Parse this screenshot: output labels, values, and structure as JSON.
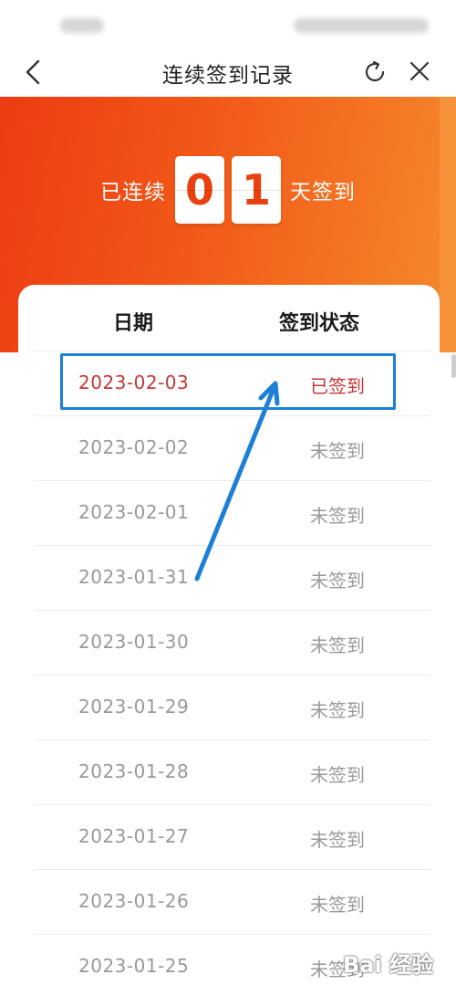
{
  "nav": {
    "title": "连续签到记录",
    "back_icon": "chevron-left-icon",
    "refresh_icon": "refresh-icon",
    "close_icon": "close-icon"
  },
  "banner": {
    "prefix": "已连续",
    "digits": [
      "0",
      "1"
    ],
    "suffix": "天签到"
  },
  "table": {
    "headers": {
      "date": "日期",
      "status": "签到状态"
    },
    "rows": [
      {
        "date": "2023-02-03",
        "status": "已签到",
        "signed": true
      },
      {
        "date": "2023-02-02",
        "status": "未签到",
        "signed": false
      },
      {
        "date": "2023-02-01",
        "status": "未签到",
        "signed": false
      },
      {
        "date": "2023-01-31",
        "status": "未签到",
        "signed": false
      },
      {
        "date": "2023-01-30",
        "status": "未签到",
        "signed": false
      },
      {
        "date": "2023-01-29",
        "status": "未签到",
        "signed": false
      },
      {
        "date": "2023-01-28",
        "status": "未签到",
        "signed": false
      },
      {
        "date": "2023-01-27",
        "status": "未签到",
        "signed": false
      },
      {
        "date": "2023-01-26",
        "status": "未签到",
        "signed": false
      },
      {
        "date": "2023-01-25",
        "status": "未签到",
        "signed": false
      }
    ]
  },
  "colors": {
    "banner_start": "#ee3b12",
    "banner_end": "#f58a2c",
    "signed_text": "#c6373a",
    "unsigned_text": "#999999",
    "annotation_blue": "#1e7fd6"
  },
  "watermark": {
    "text": "Bai 经验"
  }
}
